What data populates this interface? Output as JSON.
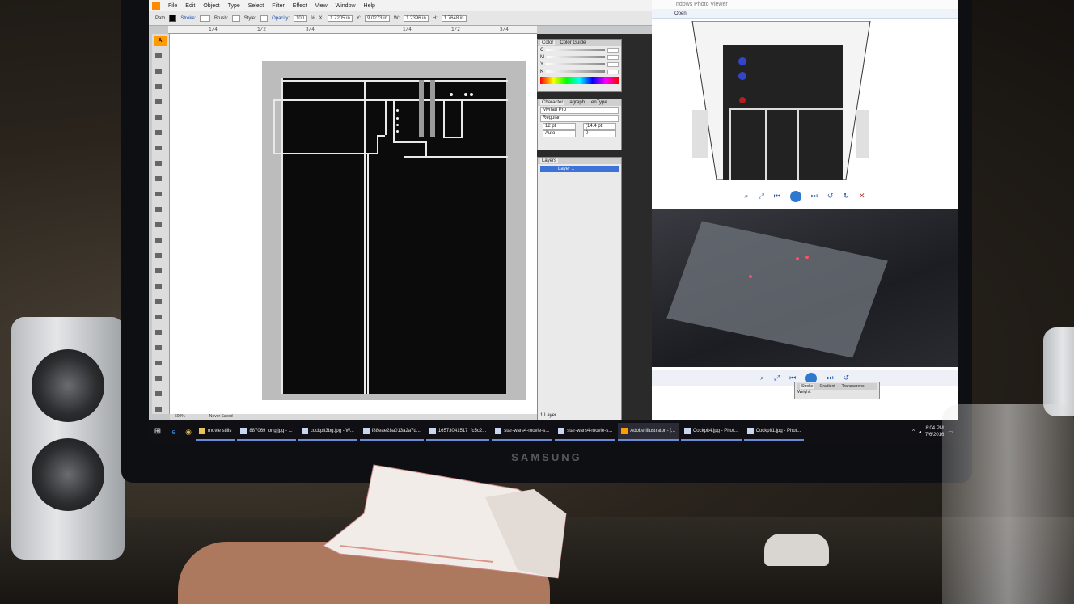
{
  "monitor": {
    "brand": "SAMSUNG"
  },
  "illustrator": {
    "menu": [
      "File",
      "Edit",
      "Object",
      "Type",
      "Select",
      "Filter",
      "Effect",
      "View",
      "Window",
      "Help"
    ],
    "control_bar": {
      "selection": "Path",
      "stroke_label": "Stroke:",
      "brush_label": "Brush:",
      "style_label": "Style:",
      "opacity_label": "Opacity:",
      "opacity_value": "100",
      "opacity_unit": "%",
      "x_label": "X:",
      "x_value": "1.7205 in",
      "y_label": "Y:",
      "y_value": "9.0273 in",
      "w_label": "W:",
      "w_value": "1.2396 in",
      "h_label": "H:",
      "h_value": "1.7648 in"
    },
    "ruler_ticks": [
      "1/4",
      "1/2",
      "3/4",
      "1/4",
      "1/2",
      "3/4"
    ],
    "toolbox_logo": "Ai",
    "status": {
      "zoom": "600%",
      "save_state": "Never Saved"
    },
    "color_panel": {
      "tabs": [
        "Color",
        "Color Guide"
      ],
      "channels": [
        "C",
        "M",
        "Y",
        "K"
      ]
    },
    "character_panel": {
      "tabs": [
        "Character",
        "agraph",
        "enType"
      ],
      "font": "Myriad Pro",
      "style": "Regular",
      "size": "12 pt",
      "leading": "(14.4 pt",
      "kerning": "Auto",
      "tracking": "0"
    },
    "layers_panel": {
      "tab": "Layers",
      "layer_name": "Layer 1",
      "footer": "1 Layer"
    }
  },
  "photo_viewer": {
    "title": "ndows Photo Viewer",
    "menu_open": "Open",
    "ctrl_glyphs": [
      "⌕",
      "⤢",
      "⏮",
      "⏭",
      "↺",
      "↻",
      "✕"
    ],
    "stroke_panel": {
      "tabs": [
        "Stroke",
        "Gradient",
        "Transparenc"
      ],
      "weight_label": "Weight:"
    }
  },
  "taskbar": {
    "items": [
      "movie stills",
      "887069_orig.jpg - ...",
      "cockpit3bg.jpg - W...",
      "f88eae28a013a2a7d...",
      "16573041517_fc5c2...",
      "star-wars4-movie-s...",
      "star-wars4-movie-s...",
      "Adobe Illustrator - [...",
      "Cockpit4.jpg - Phot...",
      "Cockpit1.jpg - Phot..."
    ],
    "time": "8:04 PM",
    "date": "7/6/2016"
  }
}
